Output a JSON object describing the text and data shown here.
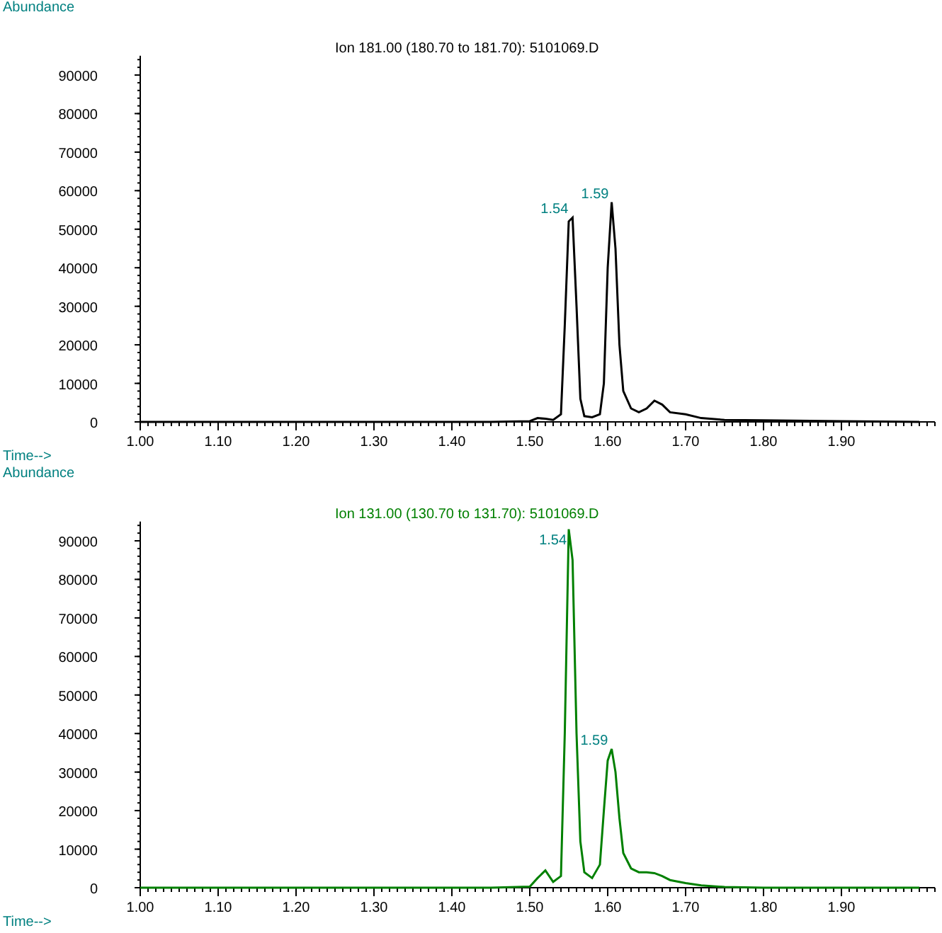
{
  "panels": [
    {
      "chart_data": {
        "type": "line",
        "title": "Ion 181.00 (180.70 to 181.70): 5101069.D",
        "xlabel": "Time-->",
        "ylabel": "Abundance",
        "xlim": [
          1.0,
          2.02
        ],
        "ylim": [
          0,
          95000
        ],
        "xticks": [
          {
            "value": 1.0,
            "label": "1.00"
          },
          {
            "value": 1.1,
            "label": "1.10"
          },
          {
            "value": 1.2,
            "label": "1.20"
          },
          {
            "value": 1.3,
            "label": "1.30"
          },
          {
            "value": 1.4,
            "label": "1.40"
          },
          {
            "value": 1.5,
            "label": "1.50"
          },
          {
            "value": 1.6,
            "label": "1.60"
          },
          {
            "value": 1.7,
            "label": "1.70"
          },
          {
            "value": 1.8,
            "label": "1.80"
          },
          {
            "value": 1.9,
            "label": "1.90"
          }
        ],
        "yticks": [
          0,
          10000,
          20000,
          30000,
          40000,
          50000,
          60000,
          70000,
          80000,
          90000
        ],
        "x": [
          1.0,
          1.45,
          1.5,
          1.51,
          1.52,
          1.53,
          1.54,
          1.545,
          1.55,
          1.555,
          1.56,
          1.565,
          1.57,
          1.58,
          1.59,
          1.595,
          1.6,
          1.605,
          1.61,
          1.615,
          1.62,
          1.63,
          1.64,
          1.65,
          1.66,
          1.67,
          1.68,
          1.7,
          1.72,
          1.75,
          1.8,
          1.9,
          2.0
        ],
        "series": [
          {
            "color": "#000000",
            "values": [
              0,
              0,
              200,
              1000,
              800,
              500,
              2000,
              25000,
              52000,
              53000,
              30000,
              6000,
              1500,
              1200,
              2000,
              10000,
              40000,
              57000,
              45000,
              20000,
              8000,
              3500,
              2500,
              3500,
              5500,
              4500,
              2500,
              2000,
              1000,
              500,
              400,
              200,
              0
            ]
          }
        ],
        "annotations": [
          {
            "text": "1.54",
            "x": 1.553,
            "y": 53000
          },
          {
            "text": "1.59",
            "x": 1.605,
            "y": 57000
          }
        ]
      }
    },
    {
      "chart_data": {
        "type": "line",
        "title": "Ion 131.00 (130.70 to 131.70): 5101069.D",
        "xlabel": "Time-->",
        "ylabel": "Abundance",
        "xlim": [
          1.0,
          2.02
        ],
        "ylim": [
          0,
          95000
        ],
        "xticks": [
          {
            "value": 1.0,
            "label": "1.00"
          },
          {
            "value": 1.1,
            "label": "1.10"
          },
          {
            "value": 1.2,
            "label": "1.20"
          },
          {
            "value": 1.3,
            "label": "1.30"
          },
          {
            "value": 1.4,
            "label": "1.40"
          },
          {
            "value": 1.5,
            "label": "1.50"
          },
          {
            "value": 1.6,
            "label": "1.60"
          },
          {
            "value": 1.7,
            "label": "1.70"
          },
          {
            "value": 1.8,
            "label": "1.80"
          },
          {
            "value": 1.9,
            "label": "1.90"
          }
        ],
        "yticks": [
          0,
          10000,
          20000,
          30000,
          40000,
          50000,
          60000,
          70000,
          80000,
          90000
        ],
        "x": [
          1.0,
          1.45,
          1.5,
          1.51,
          1.52,
          1.53,
          1.54,
          1.545,
          1.55,
          1.555,
          1.56,
          1.565,
          1.57,
          1.58,
          1.59,
          1.595,
          1.6,
          1.605,
          1.61,
          1.615,
          1.62,
          1.63,
          1.64,
          1.65,
          1.66,
          1.67,
          1.68,
          1.7,
          1.72,
          1.75,
          1.8,
          1.9,
          2.0
        ],
        "series": [
          {
            "color": "#008000",
            "values": [
              0,
              0,
              300,
              2500,
              4500,
              1500,
              3000,
              40000,
              93000,
              85000,
              40000,
              12000,
              4000,
              2500,
              6000,
              20000,
              33000,
              36000,
              30000,
              18000,
              9000,
              5000,
              4000,
              4000,
              3800,
              3000,
              2000,
              1200,
              600,
              200,
              0,
              0,
              0
            ]
          }
        ],
        "annotations": [
          {
            "text": "1.54",
            "x": 1.551,
            "y": 88000
          },
          {
            "text": "1.59",
            "x": 1.604,
            "y": 36000
          }
        ]
      }
    }
  ]
}
